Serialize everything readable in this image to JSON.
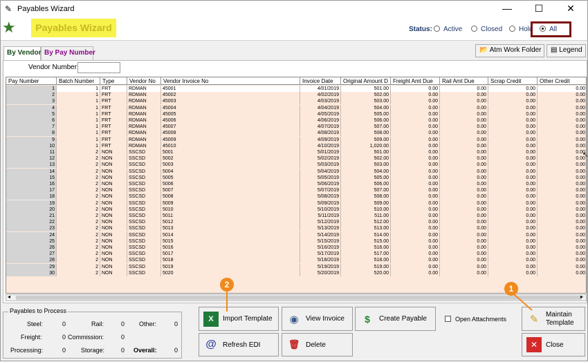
{
  "window": {
    "title": "Payables Wizard",
    "minimize": "—",
    "maximize": "☐",
    "close": "✕"
  },
  "header": {
    "app_title": "Payables Wizard",
    "status_label": "Status:",
    "status_options": [
      "Active",
      "Closed",
      "Hold",
      "All"
    ],
    "status_selected": "All"
  },
  "tabs": [
    "By Vendor",
    "By Pay Number"
  ],
  "toolbar": {
    "atm_work_folder": "Atm Work Folder",
    "legend": "Legend"
  },
  "filter": {
    "vendor_number_label": "Vendor Number:",
    "vendor_number_value": ""
  },
  "grid": {
    "columns": [
      "Pay Number",
      "Batch Number",
      "Type",
      "Vendor No",
      "Vendor Invoice No",
      "Invoice Date",
      "Original Amount D",
      "Freight Amt Due",
      "Rail Amt Due",
      "Scrap Credit",
      "Other Credit"
    ],
    "rows": [
      [
        "1",
        "1",
        "FRT",
        "RDMAN",
        "45001",
        "4/01/2019",
        "501.00",
        "0.00",
        "0.00",
        "0.00",
        "0.00"
      ],
      [
        "2",
        "1",
        "FRT",
        "RDMAN",
        "45002",
        "4/02/2019",
        "502.00",
        "0.00",
        "0.00",
        "0.00",
        "0.00"
      ],
      [
        "3",
        "1",
        "FRT",
        "RDMAN",
        "45003",
        "4/03/2019",
        "503.00",
        "0.00",
        "0.00",
        "0.00",
        "0.00"
      ],
      [
        "4",
        "1",
        "FRT",
        "RDMAN",
        "45004",
        "4/04/2019",
        "504.00",
        "0.00",
        "0.00",
        "0.00",
        "0.00"
      ],
      [
        "5",
        "1",
        "FRT",
        "RDMAN",
        "45005",
        "4/05/2019",
        "505.00",
        "0.00",
        "0.00",
        "0.00",
        "0.00"
      ],
      [
        "6",
        "1",
        "FRT",
        "RDMAN",
        "45006",
        "4/06/2019",
        "506.00",
        "0.00",
        "0.00",
        "0.00",
        "0.00"
      ],
      [
        "7",
        "1",
        "FRT",
        "RDMAN",
        "45007",
        "4/07/2019",
        "507.00",
        "0.00",
        "0.00",
        "0.00",
        "0.00"
      ],
      [
        "8",
        "1",
        "FRT",
        "RDMAN",
        "45008",
        "4/08/2019",
        "508.00",
        "0.00",
        "0.00",
        "0.00",
        "0.00"
      ],
      [
        "9",
        "1",
        "FRT",
        "RDMAN",
        "45009",
        "4/09/2019",
        "509.00",
        "0.00",
        "0.00",
        "0.00",
        "0.00"
      ],
      [
        "10",
        "1",
        "FRT",
        "RDMAN",
        "45010",
        "4/10/2019",
        "1,020.00",
        "0.00",
        "0.00",
        "0.00",
        "0.00"
      ],
      [
        "11",
        "2",
        "NON",
        "SSCSD",
        "5001",
        "5/01/2019",
        "501.00",
        "0.00",
        "0.00",
        "0.00",
        "0.00"
      ],
      [
        "12",
        "2",
        "NON",
        "SSCSD",
        "5002",
        "5/02/2019",
        "502.00",
        "0.00",
        "0.00",
        "0.00",
        "0.00"
      ],
      [
        "13",
        "2",
        "NON",
        "SSCSD",
        "5003",
        "5/03/2019",
        "503.00",
        "0.00",
        "0.00",
        "0.00",
        "0.00"
      ],
      [
        "14",
        "2",
        "NON",
        "SSCSD",
        "5004",
        "5/04/2019",
        "504.00",
        "0.00",
        "0.00",
        "0.00",
        "0.00"
      ],
      [
        "15",
        "2",
        "NON",
        "SSCSD",
        "5005",
        "5/05/2019",
        "505.00",
        "0.00",
        "0.00",
        "0.00",
        "0.00"
      ],
      [
        "16",
        "2",
        "NON",
        "SSCSD",
        "5006",
        "5/06/2019",
        "506.00",
        "0.00",
        "0.00",
        "0.00",
        "0.00"
      ],
      [
        "17",
        "2",
        "NON",
        "SSCSD",
        "5007",
        "5/07/2019",
        "507.00",
        "0.00",
        "0.00",
        "0.00",
        "0.00"
      ],
      [
        "18",
        "2",
        "NON",
        "SSCSD",
        "5008",
        "5/08/2019",
        "508.00",
        "0.00",
        "0.00",
        "0.00",
        "0.00"
      ],
      [
        "19",
        "2",
        "NON",
        "SSCSD",
        "5009",
        "5/09/2019",
        "509.00",
        "0.00",
        "0.00",
        "0.00",
        "0.00"
      ],
      [
        "20",
        "2",
        "NON",
        "SSCSD",
        "5010",
        "5/10/2019",
        "510.00",
        "0.00",
        "0.00",
        "0.00",
        "0.00"
      ],
      [
        "21",
        "2",
        "NON",
        "SSCSD",
        "5011",
        "5/11/2019",
        "511.00",
        "0.00",
        "0.00",
        "0.00",
        "0.00"
      ],
      [
        "22",
        "2",
        "NON",
        "SSCSD",
        "5012",
        "5/12/2019",
        "512.00",
        "0.00",
        "0.00",
        "0.00",
        "0.00"
      ],
      [
        "23",
        "2",
        "NON",
        "SSCSD",
        "5013",
        "5/13/2019",
        "513.00",
        "0.00",
        "0.00",
        "0.00",
        "0.00"
      ],
      [
        "24",
        "2",
        "NON",
        "SSCSD",
        "5014",
        "5/14/2019",
        "514.00",
        "0.00",
        "0.00",
        "0.00",
        "0.00"
      ],
      [
        "25",
        "2",
        "NON",
        "SSCSD",
        "5015",
        "5/15/2019",
        "515.00",
        "0.00",
        "0.00",
        "0.00",
        "0.00"
      ],
      [
        "26",
        "2",
        "NON",
        "SSCSD",
        "5016",
        "5/16/2019",
        "516.00",
        "0.00",
        "0.00",
        "0.00",
        "0.00"
      ],
      [
        "27",
        "2",
        "NON",
        "SSCSD",
        "5017",
        "5/17/2019",
        "517.00",
        "0.00",
        "0.00",
        "0.00",
        "0.00"
      ],
      [
        "28",
        "2",
        "NON",
        "SSCSD",
        "5018",
        "5/18/2019",
        "518.00",
        "0.00",
        "0.00",
        "0.00",
        "0.00"
      ],
      [
        "29",
        "2",
        "NON",
        "SSCSD",
        "5019",
        "5/19/2019",
        "519.00",
        "0.00",
        "0.00",
        "0.00",
        "0.00"
      ],
      [
        "30",
        "2",
        "NON",
        "SSCSD",
        "5020",
        "5/20/2019",
        "520.00",
        "0.00",
        "0.00",
        "0.00",
        "0.00"
      ]
    ]
  },
  "payables": {
    "title": "Payables to Process",
    "steel_label": "Steel:",
    "steel": "0",
    "rail_label": "Rail:",
    "rail": "0",
    "other_label": "Other:",
    "other": "0",
    "freight_label": "Freight:",
    "freight": "0",
    "commission_label": "Commission:",
    "commission": "0",
    "processing_label": "Processing:",
    "processing": "0",
    "storage_label": "Storage:",
    "storage": "0",
    "overall_label": "Overall:",
    "overall": "0"
  },
  "buttons": {
    "import_template": "Import Template",
    "view_invoice": "View Invoice",
    "create_payable": "Create Payable",
    "open_attachments": "Open Attachments",
    "maintain_template": "Maintain Template",
    "refresh_edi": "Refresh EDI",
    "delete": "Delete",
    "close": "Close"
  },
  "callouts": [
    "1",
    "2"
  ],
  "colors": {
    "grid_bg": "#fde9dc",
    "accent_callout": "#f08a1c",
    "title_bg": "#f7f34b",
    "highlight_border": "#7a1010"
  }
}
